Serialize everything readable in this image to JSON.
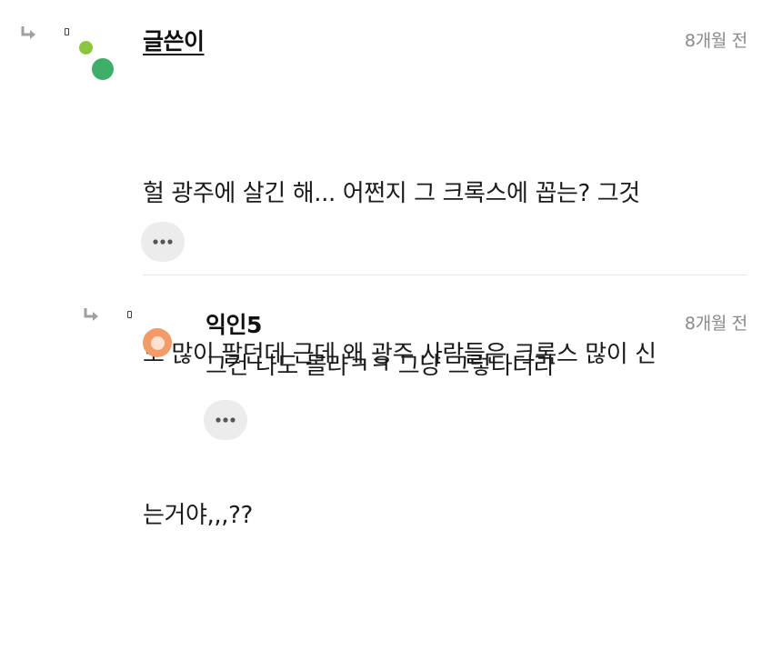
{
  "comment": {
    "author": "글쓴이",
    "time": "8개월 전",
    "lines": [
      "헐 광주에 살긴 해... 어쩐지 그 크록스에 꼽는? 그것",
      "도 많이 팔던데 근데 왜 광주 사람들은 크록스 많이 신",
      "는거야,,,??"
    ],
    "more_icon": "more-horizontal-icon",
    "avatar_colors": [
      "#8cc63f",
      "#3fae6a"
    ]
  },
  "reply": {
    "author": "익인5",
    "time": "8개월 전",
    "text": "그건 나도 몰라ㅋㅋ 그냥 그렇다더라",
    "more_icon": "more-horizontal-icon",
    "avatar_color": "#f29a68"
  }
}
